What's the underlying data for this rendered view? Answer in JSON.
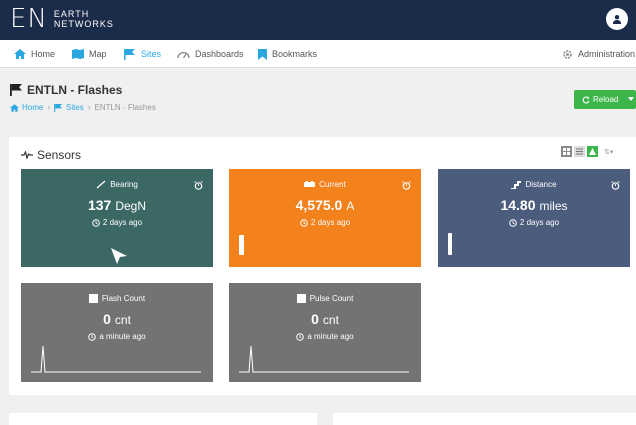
{
  "header": {
    "logo_mark": "EN",
    "logo_line1": "EARTH",
    "logo_line2": "NETWORKS"
  },
  "nav": {
    "items": [
      {
        "label": "Home",
        "icon": "home-icon"
      },
      {
        "label": "Map",
        "icon": "map-icon"
      },
      {
        "label": "Sites",
        "icon": "flag-icon",
        "active": true
      },
      {
        "label": "Dashboards",
        "icon": "dashboard-icon"
      },
      {
        "label": "Bookmarks",
        "icon": "bookmark-icon"
      }
    ],
    "admin_label": "Administration"
  },
  "page": {
    "title": "ENTLN - Flashes",
    "breadcrumb": [
      "Home",
      "Sites",
      "ENTLN - Flashes"
    ],
    "reload_label": "Reload"
  },
  "sensors": {
    "title": "Sensors",
    "tiles": [
      {
        "name": "Bearing",
        "value": "137",
        "unit": "DegN",
        "time": "2 days ago",
        "color": "#3b6865"
      },
      {
        "name": "Current",
        "value": "4,575.0",
        "unit": "A",
        "time": "2 days ago",
        "color": "#f3811c"
      },
      {
        "name": "Distance",
        "value": "14.80",
        "unit": "miles",
        "time": "2 days ago",
        "color": "#4c5c7d"
      },
      {
        "name": "Flash Count",
        "value": "0",
        "unit": "cnt",
        "time": "a minute ago",
        "color": "#737373"
      },
      {
        "name": "Pulse Count",
        "value": "0",
        "unit": "cnt",
        "time": "a minute ago",
        "color": "#737373"
      }
    ]
  },
  "colors": {
    "header_bg": "#1b2b4a",
    "accent": "#2aa7e0",
    "reload_green": "#3cb54a"
  }
}
